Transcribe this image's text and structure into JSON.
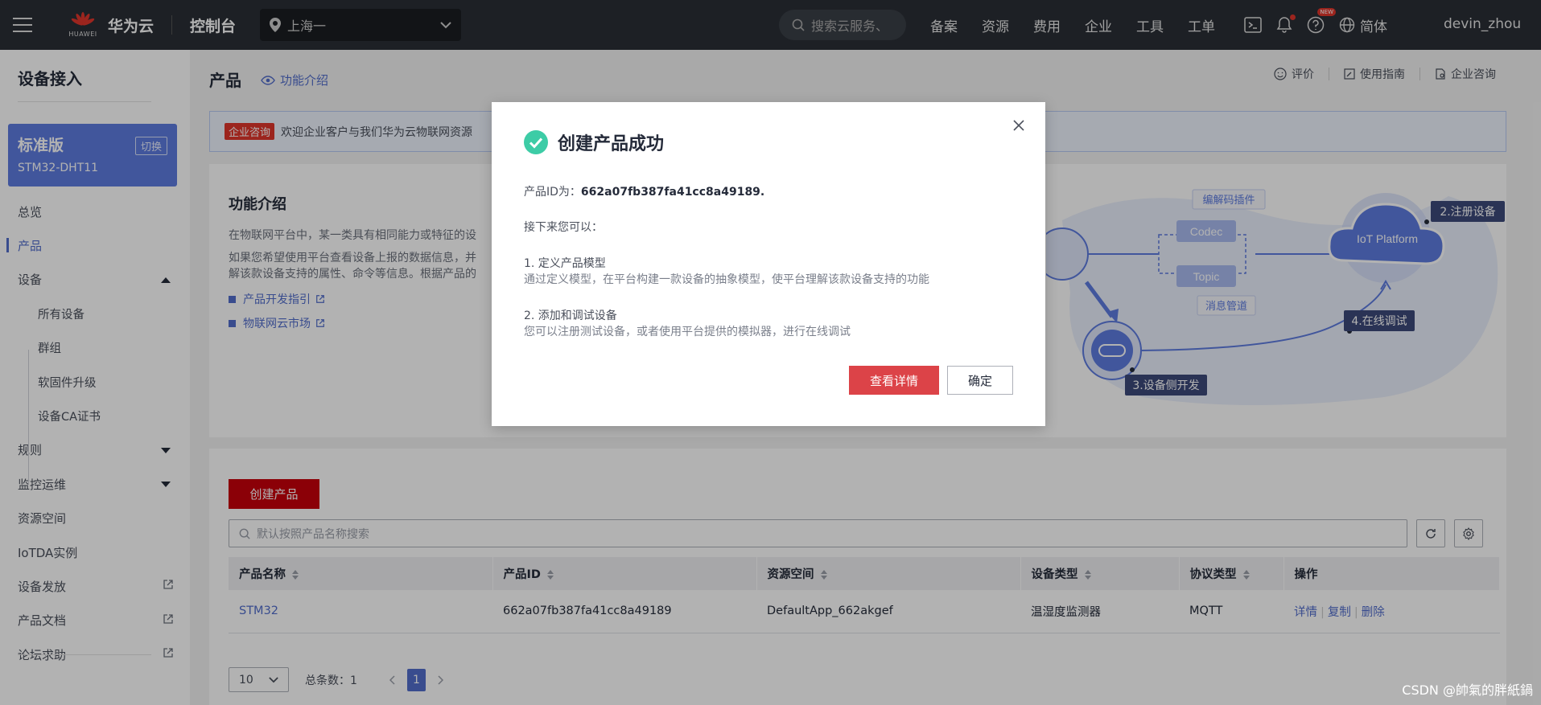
{
  "topbar": {
    "logo_text": "HUAWEI",
    "brand": "华为云",
    "console": "控制台",
    "region": "上海一",
    "search_placeholder": "搜索云服务、",
    "nav": [
      "备案",
      "资源",
      "费用",
      "企业",
      "工具",
      "工单"
    ],
    "new_badge": "NEW",
    "lang": "简体",
    "user": "devin_zhou"
  },
  "sidebar": {
    "title": "设备接入",
    "edition": {
      "name": "标准版",
      "switch": "切换",
      "instance": "STM32-DHT11"
    },
    "items": [
      {
        "label": "总览"
      },
      {
        "label": "产品"
      },
      {
        "label": "设备"
      },
      {
        "label": "所有设备"
      },
      {
        "label": "群组"
      },
      {
        "label": "软固件升级"
      },
      {
        "label": "设备CA证书"
      },
      {
        "label": "规则"
      },
      {
        "label": "监控运维"
      },
      {
        "label": "资源空间"
      },
      {
        "label": "IoTDA实例"
      },
      {
        "label": "设备发放"
      },
      {
        "label": "产品文档"
      },
      {
        "label": "论坛求助"
      }
    ]
  },
  "header": {
    "title": "产品",
    "intro_link": "功能介绍",
    "right": {
      "rate": "评价",
      "guide": "使用指南",
      "consult": "企业咨询"
    }
  },
  "banner": {
    "tag": "企业咨询",
    "text": "欢迎企业客户与我们华为云物联网资源"
  },
  "intro": {
    "title": "功能介绍",
    "p1": "在物联网平台中，某一类具有相同能力或特征的设",
    "p2a": "如果您希望使用平台查看设备上报的数据信息，并",
    "p2b": "解该款设备支持的属性、命令等信息。根据产品的",
    "link1": "产品开发指引",
    "link2": "物联网云市场",
    "diagram": {
      "codec_plugin": "编解码插件",
      "codec": "Codec",
      "topic": "Topic",
      "msg_pipe": "消息管道",
      "iot_platform": "IoT Platform",
      "step2": "2.注册设备",
      "step3": "3.设备侧开发",
      "step4": "4.在线调试"
    }
  },
  "list": {
    "create_button": "创建产品",
    "search_placeholder": "默认按照产品名称搜索",
    "columns": [
      "产品名称",
      "产品ID",
      "资源空间",
      "设备类型",
      "协议类型",
      "操作"
    ],
    "rows": [
      {
        "name": "STM32",
        "id": "662a07fb387fa41cc8a49189",
        "space": "DefaultApp_662akgef",
        "device_type": "温湿度监测器",
        "protocol": "MQTT",
        "ops": [
          "详情",
          "复制",
          "删除"
        ]
      }
    ],
    "page_size": "10",
    "total": "总条数：1",
    "current_page": "1"
  },
  "modal": {
    "title": "创建产品成功",
    "id_label": "产品ID为：",
    "id_value": "662a07fb387fa41cc8a49189.",
    "next": "接下来您可以：",
    "step1_title": "1. 定义产品模型",
    "step1_desc": "通过定义模型，在平台构建一款设备的抽象模型，使平台理解该款设备支持的功能",
    "step2_title": "2. 添加和调试设备",
    "step2_desc": "您可以注册测试设备，或者使用平台提供的模拟器，进行在线调试",
    "detail_button": "查看详情",
    "ok_button": "确定"
  },
  "watermark": "CSDN @帥氣的胖紙鍋",
  "colors": {
    "topbar": "#2a2e35",
    "accent": "#526ecc",
    "create": "#c7000b",
    "modal_primary": "#dc4348",
    "success": "#3dcca6"
  }
}
